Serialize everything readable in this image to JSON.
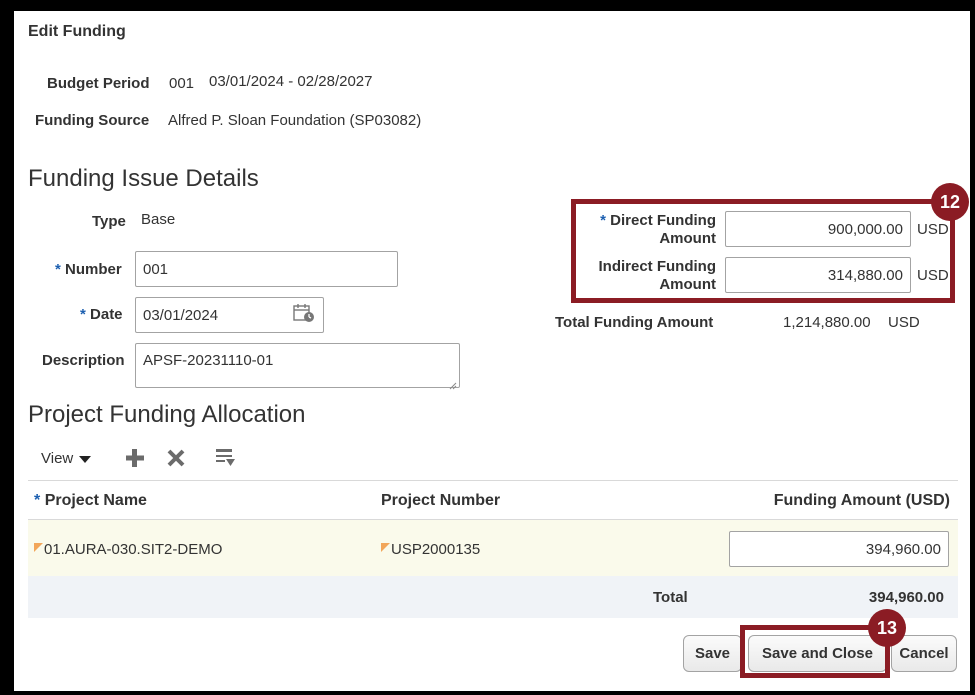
{
  "page_title": "Edit Funding",
  "budget_period": {
    "label": "Budget Period",
    "number": "001",
    "range": "03/01/2024 - 02/28/2027"
  },
  "funding_source": {
    "label": "Funding Source",
    "value": "Alfred P. Sloan Foundation (SP03082)"
  },
  "issue_details": {
    "heading": "Funding Issue Details",
    "type_label": "Type",
    "type_value": "Base",
    "required_mark": "*",
    "number_label": "Number",
    "number_value": "001",
    "date_label": "Date",
    "date_value": "03/01/2024",
    "description_label": "Description",
    "description_value": "APSF-20231110-01"
  },
  "amounts": {
    "direct_label_1": "Direct Funding",
    "direct_label_2": "Amount",
    "direct_value": "900,000.00",
    "indirect_label_1": "Indirect Funding",
    "indirect_label_2": "Amount",
    "indirect_value": "314,880.00",
    "currency": "USD",
    "total_label": "Total Funding Amount",
    "total_value": "1,214,880.00",
    "total_currency": "USD"
  },
  "callouts": {
    "step_12": "12",
    "step_13": "13"
  },
  "allocation": {
    "heading": "Project Funding Allocation",
    "view_label": "View",
    "columns": {
      "project_name": "Project Name",
      "project_number": "Project Number",
      "funding_amount": "Funding Amount (USD)"
    },
    "rows": [
      {
        "project_name": "01.AURA-030.SIT2-DEMO",
        "project_number": "USP2000135",
        "funding_amount": "394,960.00"
      }
    ],
    "total_label": "Total",
    "total_value": "394,960.00"
  },
  "buttons": {
    "save": "Save",
    "save_and_close": "Save and Close",
    "cancel": "Cancel"
  },
  "colors": {
    "callout": "#8b1c24",
    "required": "#1c5fb0",
    "row_highlight": "#fafaeb",
    "total_row": "#f0f3f7"
  }
}
